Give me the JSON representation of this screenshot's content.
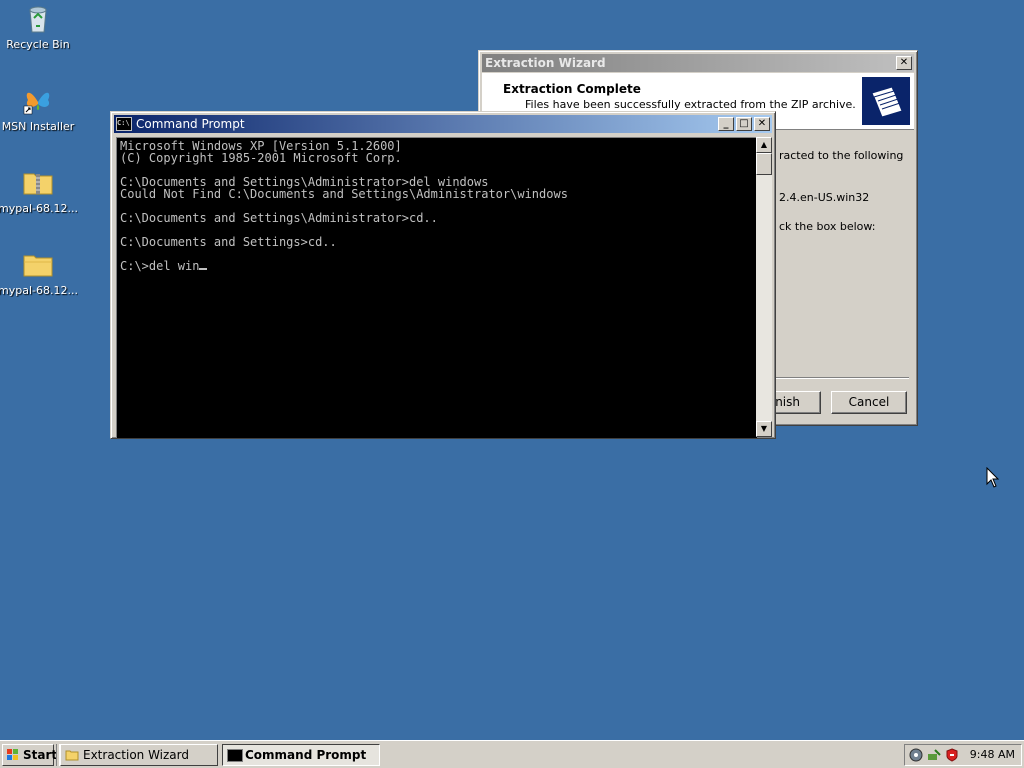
{
  "desktop": {
    "icons": [
      {
        "label": "Recycle Bin"
      },
      {
        "label": "MSN Installer"
      },
      {
        "label": "mypal-68.12..."
      },
      {
        "label": "mypal-68.12..."
      }
    ]
  },
  "wizard": {
    "title": "Extraction Wizard",
    "heading": "Extraction Complete",
    "subheading": "Files have been successfully extracted from the ZIP archive.",
    "body_line1": "racted to the following",
    "body_line2": "2.4.en-US.win32",
    "body_line3": "ck the box below:",
    "finish_label": "nish",
    "cancel_label": "Cancel"
  },
  "console": {
    "title": "Command Prompt",
    "lines": [
      "Microsoft Windows XP [Version 5.1.2600]",
      "(C) Copyright 1985-2001 Microsoft Corp.",
      "",
      "C:\\Documents and Settings\\Administrator>del windows",
      "Could Not Find C:\\Documents and Settings\\Administrator\\windows",
      "",
      "C:\\Documents and Settings\\Administrator>cd..",
      "",
      "C:\\Documents and Settings>cd..",
      "",
      "C:\\>del win"
    ]
  },
  "taskbar": {
    "start_label": "Start",
    "tasks": [
      {
        "label": "Extraction Wizard"
      },
      {
        "label": "Command Prompt"
      }
    ],
    "clock": "9:48 AM"
  }
}
